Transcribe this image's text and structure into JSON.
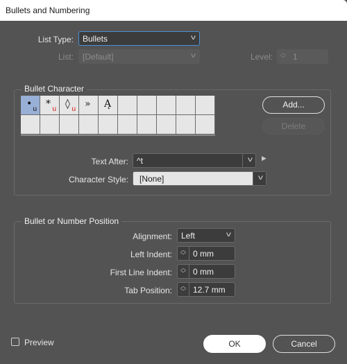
{
  "window": {
    "title": "Bullets and Numbering"
  },
  "list_type": {
    "label": "List Type:",
    "value": "Bullets"
  },
  "list": {
    "label": "List:",
    "value": "[Default]"
  },
  "level": {
    "label": "Level:",
    "value": "1"
  },
  "bullet_character": {
    "title": "Bullet Character",
    "glyphs": [
      {
        "glyph": "•",
        "unicode_mark": "u",
        "selected": true
      },
      {
        "glyph": "*",
        "unicode_mark": "u",
        "selected": false
      },
      {
        "glyph": "◊",
        "unicode_mark": "u",
        "selected": false
      },
      {
        "glyph": "»",
        "unicode_mark": "",
        "selected": false
      },
      {
        "glyph": "Ą",
        "unicode_mark": "",
        "selected": false
      }
    ],
    "add_label": "Add...",
    "delete_label": "Delete",
    "text_after": {
      "label": "Text After:",
      "value": "^t"
    },
    "character_style": {
      "label": "Character Style:",
      "value": "[None]"
    }
  },
  "position": {
    "title": "Bullet or Number Position",
    "alignment": {
      "label": "Alignment:",
      "value": "Left"
    },
    "left_indent": {
      "label": "Left Indent:",
      "value": "0 mm"
    },
    "first_line_indent": {
      "label": "First Line Indent:",
      "value": "0 mm"
    },
    "tab_position": {
      "label": "Tab Position:",
      "value": "12.7 mm"
    }
  },
  "footer": {
    "preview_label": "Preview",
    "preview_checked": false,
    "ok_label": "OK",
    "cancel_label": "Cancel"
  }
}
